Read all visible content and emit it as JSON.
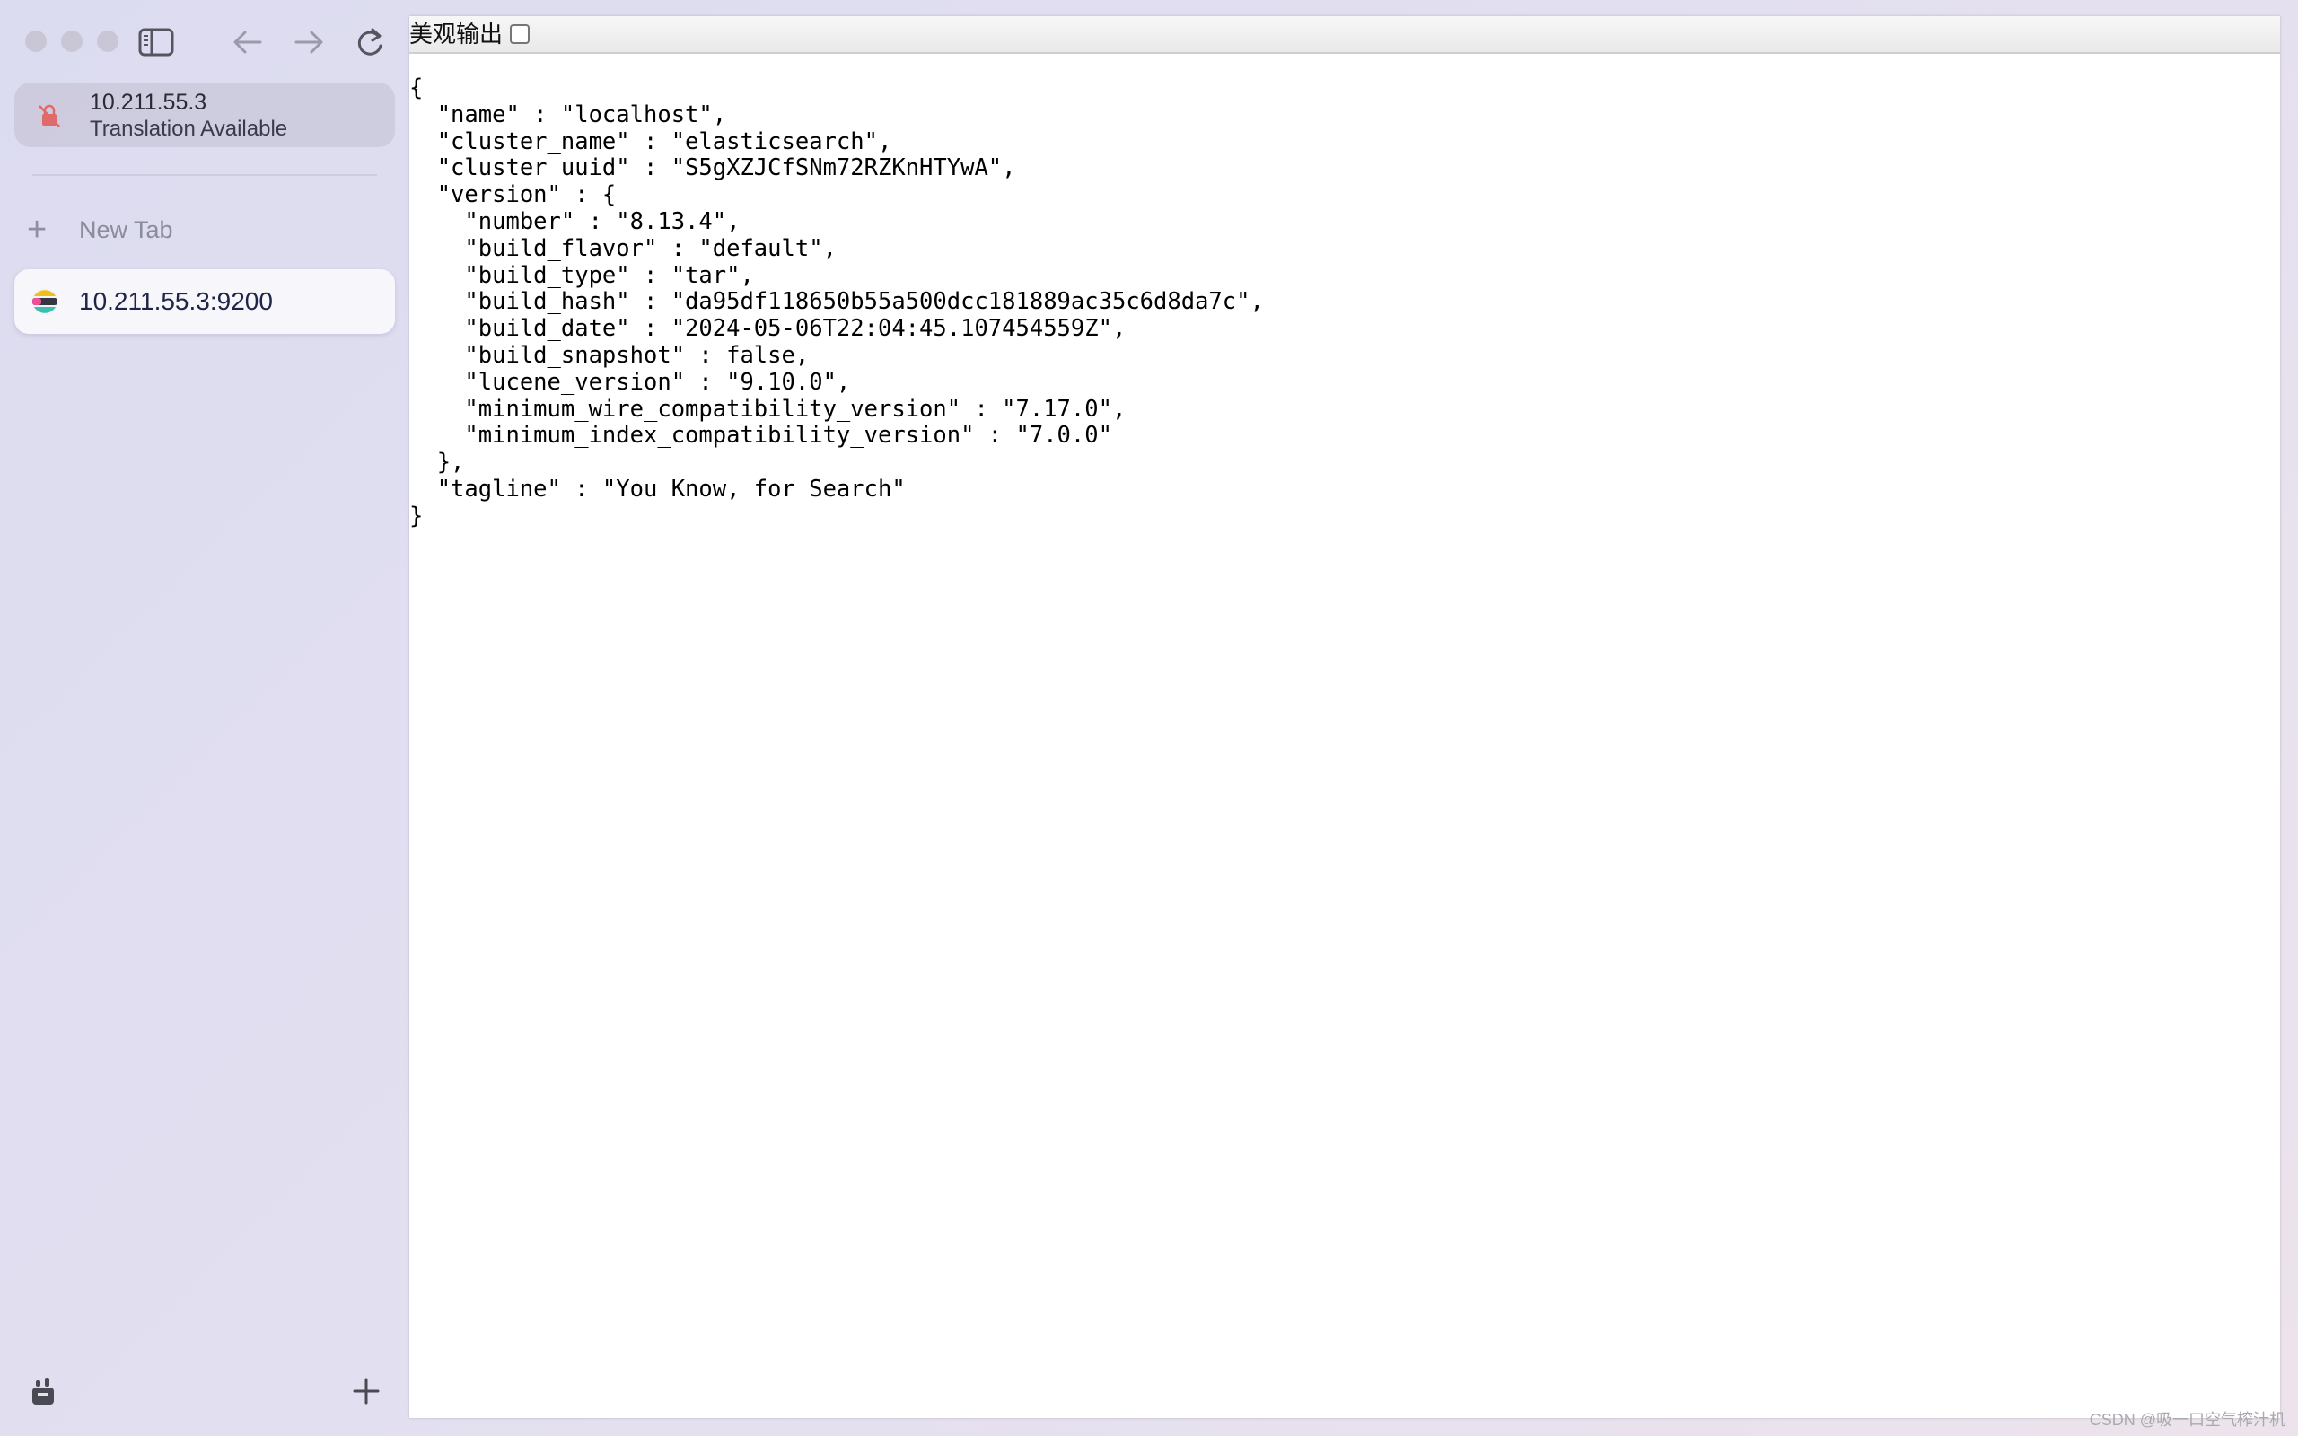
{
  "sidebar": {
    "address_card": {
      "host": "10.211.55.3",
      "subtitle": "Translation Available"
    },
    "new_tab_label": "New Tab",
    "tabs": [
      {
        "label": "10.211.55.3:9200"
      }
    ]
  },
  "content": {
    "pretty_print_label": "美观输出",
    "pretty_print_checked": false,
    "json_text": "{\n  \"name\" : \"localhost\",\n  \"cluster_name\" : \"elasticsearch\",\n  \"cluster_uuid\" : \"S5gXZJCfSNm72RZKnHTYwA\",\n  \"version\" : {\n    \"number\" : \"8.13.4\",\n    \"build_flavor\" : \"default\",\n    \"build_type\" : \"tar\",\n    \"build_hash\" : \"da95df118650b55a500dcc181889ac35c6d8da7c\",\n    \"build_date\" : \"2024-05-06T22:04:45.107454559Z\",\n    \"build_snapshot\" : false,\n    \"lucene_version\" : \"9.10.0\",\n    \"minimum_wire_compatibility_version\" : \"7.17.0\",\n    \"minimum_index_compatibility_version\" : \"7.0.0\"\n  },\n  \"tagline\" : \"You Know, for Search\"\n}"
  },
  "watermark": "CSDN @吸一口空气榨汁机",
  "icons": [
    "close-window-icon",
    "minimize-window-icon",
    "zoom-window-icon",
    "sidebar-toggle-icon",
    "back-arrow-icon",
    "forward-arrow-icon",
    "reload-icon",
    "insecure-lock-icon",
    "plus-icon",
    "elastic-favicon-icon",
    "tab-groups-icon",
    "new-tab-plus-icon"
  ]
}
